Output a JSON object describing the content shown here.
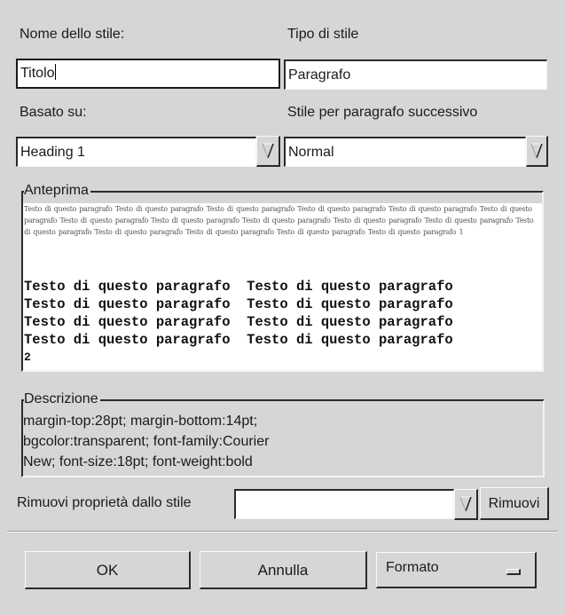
{
  "labels": {
    "style_name": "Nome dello stile:",
    "style_type": "Tipo di stile",
    "based_on": "Basato su:",
    "next_style": "Stile per paragrafo successivo",
    "remove_property": "Rimuovi proprietà dallo stile"
  },
  "fields": {
    "style_name_value": "Titolo",
    "style_type_value": "Paragrafo",
    "based_on_value": "Heading 1",
    "next_style_value": "Normal",
    "remove_property_value": ""
  },
  "preview": {
    "title": "Anteprima",
    "previous_paragraph_text": "Testo di questo paragrafo  Testo di questo paragrafo  Testo di questo paragrafo  Testo di questo paragrafo  Testo di questo paragrafo  Testo di questo paragrafo  Testo di questo paragrafo  Testo di questo paragrafo  Testo di questo paragrafo  Testo di questo paragrafo  Testo di questo paragrafo  Testo di questo paragrafo  Testo di questo paragrafo  Testo di questo paragrafo  Testo di questo paragrafo  Testo di questo paragrafo  1",
    "styled_lines": [
      "Testo di questo paragrafo  Testo di questo paragrafo",
      "Testo di questo paragrafo  Testo di questo paragrafo",
      "Testo di questo paragrafo  Testo di questo paragrafo",
      "Testo di questo paragrafo  Testo di questo paragrafo",
      "2"
    ]
  },
  "description": {
    "title": "Descrizione",
    "lines": [
      "margin-top:28pt; margin-bottom:14pt;",
      "bgcolor:transparent; font-family:Courier",
      "New; font-size:18pt; font-weight:bold"
    ]
  },
  "buttons": {
    "remove": "Rimuovi",
    "ok": "OK",
    "cancel": "Annulla",
    "format": "Formato"
  },
  "icons": {
    "combo_arrow": "down-triangle-icon",
    "menu_indicator": "menu-indicator-icon"
  },
  "colors": {
    "background": "#d6d6d6",
    "field_background": "#ffffff",
    "border_dark": "#2a2a2a"
  }
}
